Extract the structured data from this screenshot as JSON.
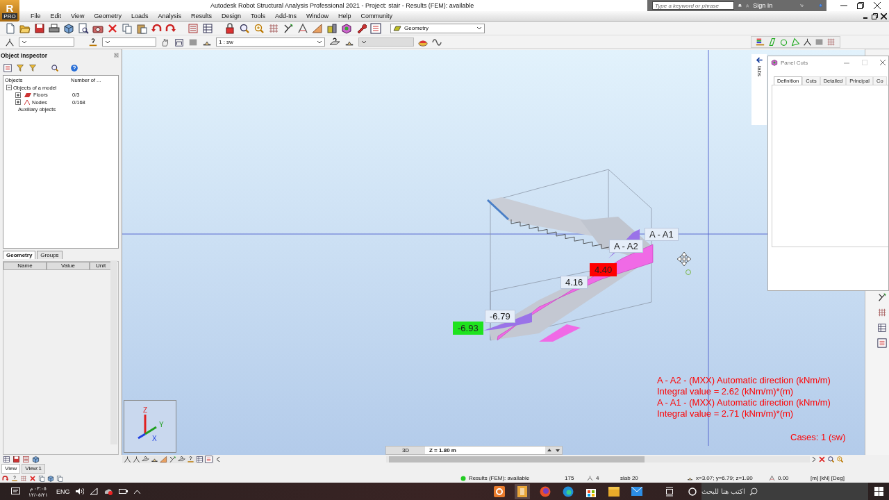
{
  "app_logo": {
    "letter": "R",
    "edition": "PRO"
  },
  "window": {
    "title": "Autodesk Robot Structural Analysis Professional 2021 - Project: stair - Results (FEM): available"
  },
  "search": {
    "placeholder": "Type a keyword or phrase"
  },
  "account": {
    "sign_in": "Sign In"
  },
  "menu": [
    "File",
    "Edit",
    "View",
    "Geometry",
    "Loads",
    "Analysis",
    "Results",
    "Design",
    "Tools",
    "Add-Ins",
    "Window",
    "Help",
    "Community"
  ],
  "toolbar": {
    "layout_dropdown": "Geometry",
    "case_dropdown": "1 : sw"
  },
  "object_inspector": {
    "title": "Object Inspector",
    "columns": [
      "Objects",
      "Number of ..."
    ],
    "tree": [
      {
        "label": "Objects of a model",
        "expanded": true,
        "children": [
          {
            "label": "Floors",
            "count": "0/3",
            "expanded": false
          },
          {
            "label": "Nodes",
            "count": "0/168",
            "expanded": false
          }
        ]
      },
      {
        "label": "Auxiliary objects"
      }
    ],
    "tabs": [
      {
        "label": "Geometry",
        "selected": true
      },
      {
        "label": "Groups",
        "selected": false
      }
    ],
    "property_columns": [
      "Name",
      "Value",
      "Unit"
    ]
  },
  "view": {
    "labels": [
      {
        "text": "A - A1",
        "kind": "section"
      },
      {
        "text": "A - A2",
        "kind": "section"
      },
      {
        "text": "4.40",
        "kind": "max"
      },
      {
        "text": "4.16",
        "kind": "value"
      },
      {
        "text": "-6.79",
        "kind": "value"
      },
      {
        "text": "-6.93",
        "kind": "min"
      }
    ],
    "legend": [
      "A - A2 - (MXX) Automatic direction (kNm/m)",
      "Integral value = 2.62 (kNm/m)*(m)",
      "A - A1 - (MXX) Automatic direction (kNm/m)",
      "Integral value = 2.71 (kNm/m)*(m)"
    ],
    "cases": "Cases: 1 (sw)",
    "axes": [
      "Z",
      "Y",
      "X"
    ],
    "projection": "3D",
    "level": "Z = 1.80 m",
    "side_tab": "tabs"
  },
  "panel_cuts": {
    "title": "Panel Cuts",
    "tabs": [
      {
        "label": "Definition",
        "selected": true
      },
      {
        "label": "Cuts",
        "selected": false
      },
      {
        "label": "Detailed",
        "selected": false
      },
      {
        "label": "Principal",
        "selected": false
      },
      {
        "label": "Co",
        "selected": false
      }
    ]
  },
  "view_tabs": [
    {
      "label": "View",
      "selected": true
    },
    {
      "label": "View:1",
      "selected": false
    }
  ],
  "status_bar": {
    "results": "Results (FEM): available",
    "count": "175",
    "layer": "4",
    "element": "slab 20",
    "coordinates": "x=3.07; y=6.79; z=1.80",
    "angle": "0.00",
    "units": "[m] [kN] [Deg]"
  },
  "taskbar": {
    "search_placeholder": "اكتب هنا للبحث",
    "language": "ENG",
    "time": "٠٣:٠٥ م",
    "date": "١٢/٠٥/٢١"
  }
}
